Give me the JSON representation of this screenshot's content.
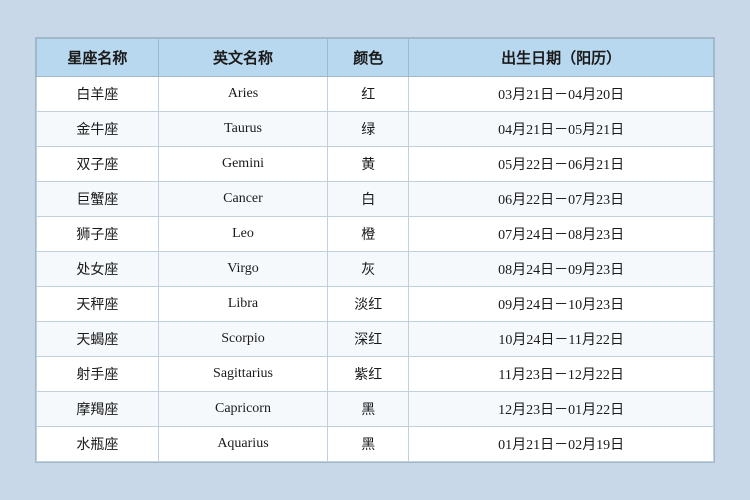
{
  "table": {
    "headers": [
      "星座名称",
      "英文名称",
      "颜色",
      "出生日期（阳历）"
    ],
    "rows": [
      {
        "name": "白羊座",
        "en": "Aries",
        "color": "红",
        "date": "03月21日－04月20日"
      },
      {
        "name": "金牛座",
        "en": "Taurus",
        "color": "绿",
        "date": "04月21日－05月21日"
      },
      {
        "name": "双子座",
        "en": "Gemini",
        "color": "黄",
        "date": "05月22日－06月21日"
      },
      {
        "name": "巨蟹座",
        "en": "Cancer",
        "color": "白",
        "date": "06月22日－07月23日"
      },
      {
        "name": "狮子座",
        "en": "Leo",
        "color": "橙",
        "date": "07月24日－08月23日"
      },
      {
        "name": "处女座",
        "en": "Virgo",
        "color": "灰",
        "date": "08月24日－09月23日"
      },
      {
        "name": "天秤座",
        "en": "Libra",
        "color": "淡红",
        "date": "09月24日－10月23日"
      },
      {
        "name": "天蝎座",
        "en": "Scorpio",
        "color": "深红",
        "date": "10月24日－11月22日"
      },
      {
        "name": "射手座",
        "en": "Sagittarius",
        "color": "紫红",
        "date": "11月23日－12月22日"
      },
      {
        "name": "摩羯座",
        "en": "Capricorn",
        "color": "黑",
        "date": "12月23日－01月22日"
      },
      {
        "name": "水瓶座",
        "en": "Aquarius",
        "color": "黑",
        "date": "01月21日－02月19日"
      }
    ]
  }
}
